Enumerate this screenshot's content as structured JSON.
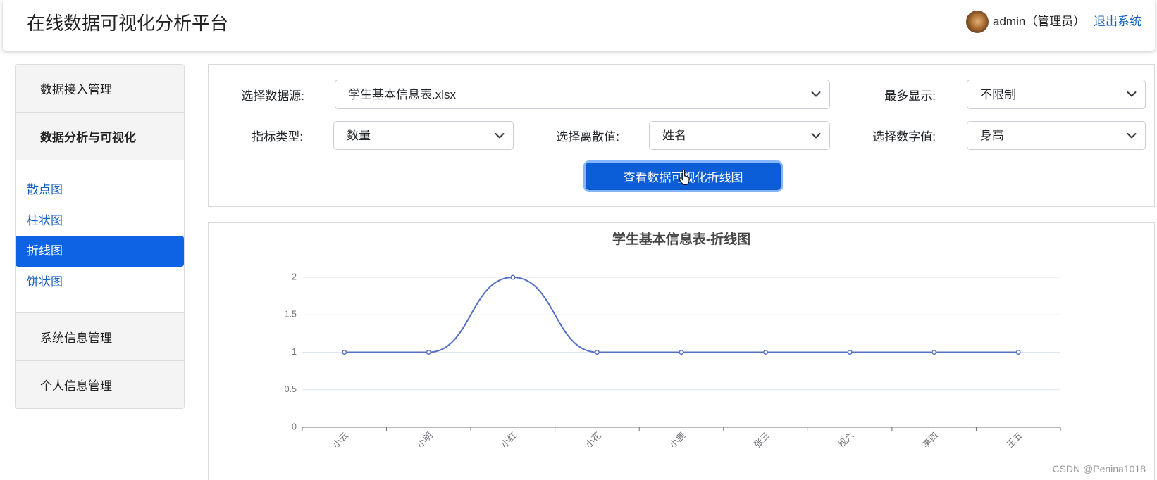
{
  "header": {
    "title": "在线数据可视化分析平台",
    "avatar_icon": "user-avatar",
    "user_label": "admin（管理员）",
    "logout_label": "退出系统"
  },
  "sidebar": {
    "menus": [
      {
        "label": "数据接入管理"
      },
      {
        "label": "数据分析与可视化"
      },
      {
        "label": "系统信息管理"
      },
      {
        "label": "个人信息管理"
      }
    ],
    "sub_items": [
      "散点图",
      "柱状图",
      "折线图",
      "饼状图"
    ],
    "active_sub_index": 2
  },
  "form": {
    "datasource": {
      "label": "选择数据源:",
      "value": "学生基本信息表.xlsx"
    },
    "max_display": {
      "label": "最多显示:",
      "value": "不限制"
    },
    "metric_type": {
      "label": "指标类型:",
      "value": "数量"
    },
    "discrete_field": {
      "label": "选择离散值:",
      "value": "姓名"
    },
    "numeric_field": {
      "label": "选择数字值:",
      "value": "身高"
    },
    "submit_label": "查看数据可视化折线图",
    "dropdown_icon": "chevron-down-icon",
    "cursor_icon": "hand-pointer-icon"
  },
  "chart_data": {
    "type": "line",
    "title": "学生基本信息表-折线图",
    "xlabel": "",
    "ylabel": "",
    "categories": [
      "小云",
      "小明",
      "小红",
      "小花",
      "小鹿",
      "张三",
      "找六",
      "李四",
      "王五"
    ],
    "series": [
      {
        "values": [
          1,
          1,
          2,
          1,
          1,
          1,
          1,
          1,
          1
        ]
      }
    ],
    "ylim": [
      0,
      2
    ],
    "yticks": [
      0,
      0.5,
      1,
      1.5,
      2
    ],
    "smooth": true,
    "grid": true,
    "x_label_rotation_deg": 45
  },
  "watermark": "CSDN @Penina1018",
  "colors": {
    "primary_button": "#0b5ed7",
    "active_menu": "#0d63e3",
    "link": "#1560bd",
    "series": "#5470c6",
    "grid": "#E0E6F1",
    "axis": "#6E7079"
  }
}
